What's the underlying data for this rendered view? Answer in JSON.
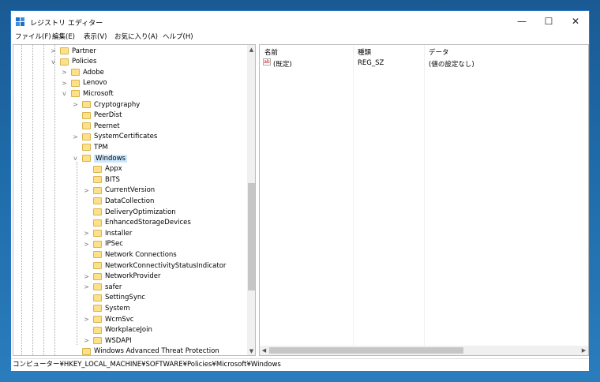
{
  "window": {
    "title": "レジストリ エディター"
  },
  "controls": {
    "minimize": "—",
    "maximize": "☐",
    "close": "✕"
  },
  "menu": [
    "ファイル(F)",
    "編集(E)",
    "表示(V)",
    "お気に入り(A)",
    "ヘルプ(H)"
  ],
  "tree": [
    {
      "label": "Partner",
      "indent": 0,
      "exp": ">"
    },
    {
      "label": "Policies",
      "indent": 0,
      "exp": "v"
    },
    {
      "label": "Adobe",
      "indent": 1,
      "exp": ">"
    },
    {
      "label": "Lenovo",
      "indent": 1,
      "exp": ">"
    },
    {
      "label": "Microsoft",
      "indent": 1,
      "exp": "v"
    },
    {
      "label": "Cryptography",
      "indent": 2,
      "exp": ">"
    },
    {
      "label": "PeerDist",
      "indent": 2,
      "exp": ""
    },
    {
      "label": "Peernet",
      "indent": 2,
      "exp": ""
    },
    {
      "label": "SystemCertificates",
      "indent": 2,
      "exp": ">"
    },
    {
      "label": "TPM",
      "indent": 2,
      "exp": ""
    },
    {
      "label": "Windows",
      "indent": 2,
      "exp": "v",
      "selected": true
    },
    {
      "label": "Appx",
      "indent": 3,
      "exp": ""
    },
    {
      "label": "BITS",
      "indent": 3,
      "exp": ""
    },
    {
      "label": "CurrentVersion",
      "indent": 3,
      "exp": ">"
    },
    {
      "label": "DataCollection",
      "indent": 3,
      "exp": ""
    },
    {
      "label": "DeliveryOptimization",
      "indent": 3,
      "exp": ""
    },
    {
      "label": "EnhancedStorageDevices",
      "indent": 3,
      "exp": ""
    },
    {
      "label": "Installer",
      "indent": 3,
      "exp": ">"
    },
    {
      "label": "IPSec",
      "indent": 3,
      "exp": ">"
    },
    {
      "label": "Network Connections",
      "indent": 3,
      "exp": ""
    },
    {
      "label": "NetworkConnectivityStatusIndicator",
      "indent": 3,
      "exp": ""
    },
    {
      "label": "NetworkProvider",
      "indent": 3,
      "exp": ">"
    },
    {
      "label": "safer",
      "indent": 3,
      "exp": ">"
    },
    {
      "label": "SettingSync",
      "indent": 3,
      "exp": ""
    },
    {
      "label": "System",
      "indent": 3,
      "exp": ""
    },
    {
      "label": "WcmSvc",
      "indent": 3,
      "exp": ">"
    },
    {
      "label": "WorkplaceJoin",
      "indent": 3,
      "exp": ""
    },
    {
      "label": "WSDAPI",
      "indent": 3,
      "exp": ">"
    },
    {
      "label": "Windows Advanced Threat Protection",
      "indent": 2,
      "exp": ""
    }
  ],
  "list": {
    "headers": {
      "name": "名前",
      "type": "種類",
      "data": "データ"
    },
    "rows": [
      {
        "icon": "ab",
        "name": "(既定)",
        "type": "REG_SZ",
        "data": "(値の設定なし)"
      }
    ]
  },
  "status": "コンピューター¥HKEY_LOCAL_MACHINE¥SOFTWARE¥Policies¥Microsoft¥Windows",
  "colors": {
    "selection": "#cce8ff",
    "folder": "#ffe08a",
    "border": "#2b78c8"
  }
}
